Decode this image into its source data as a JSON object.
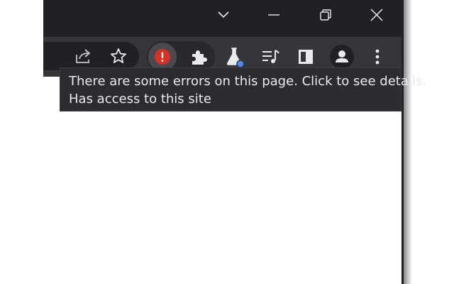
{
  "window_controls": {
    "tab_search": "chevron-down-icon",
    "minimize": "minimize-icon",
    "restore": "restore-icon",
    "close": "close-icon"
  },
  "toolbar": {
    "icons": [
      "share-icon",
      "bookmark-star-icon",
      "extension-error-icon",
      "extensions-puzzle-icon",
      "chrome-labs-flask-icon",
      "reading-list-icon",
      "side-panel-icon",
      "profile-avatar-icon",
      "more-menu-icon"
    ]
  },
  "tooltip": {
    "line1": "There are some errors on this page. Click to see details.",
    "line2": "Has access to this site"
  },
  "colors": {
    "titlebar": "#202124",
    "toolbar": "#35363a",
    "error_red": "#d93025",
    "labs_dot": "#4c8bf5",
    "tooltip_bg": "#2b2c2f"
  }
}
